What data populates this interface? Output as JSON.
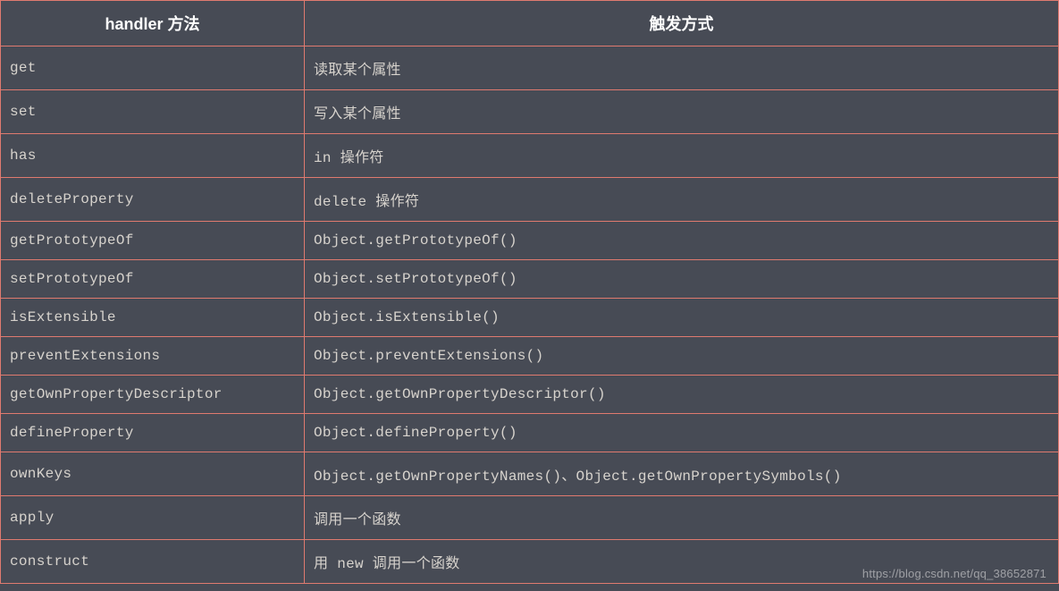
{
  "table": {
    "headers": {
      "method": "handler 方法",
      "trigger": "触发方式"
    },
    "rows": [
      {
        "method": "get",
        "trigger": "读取某个属性"
      },
      {
        "method": "set",
        "trigger": "写入某个属性"
      },
      {
        "method": "has",
        "trigger": "in 操作符"
      },
      {
        "method": "deleteProperty",
        "trigger": "delete 操作符"
      },
      {
        "method": "getPrototypeOf",
        "trigger": "Object.getPrototypeOf()"
      },
      {
        "method": "setPrototypeOf",
        "trigger": "Object.setPrototypeOf()"
      },
      {
        "method": "isExtensible",
        "trigger": "Object.isExtensible()"
      },
      {
        "method": "preventExtensions",
        "trigger": "Object.preventExtensions()"
      },
      {
        "method": "getOwnPropertyDescriptor",
        "trigger": "Object.getOwnPropertyDescriptor()"
      },
      {
        "method": "defineProperty",
        "trigger": "Object.defineProperty()"
      },
      {
        "method": "ownKeys",
        "trigger": "Object.getOwnPropertyNames()、Object.getOwnPropertySymbols()"
      },
      {
        "method": "apply",
        "trigger": "调用一个函数"
      },
      {
        "method": "construct",
        "trigger": "用 new 调用一个函数"
      }
    ]
  },
  "watermark": "https://blog.csdn.net/qq_38652871"
}
